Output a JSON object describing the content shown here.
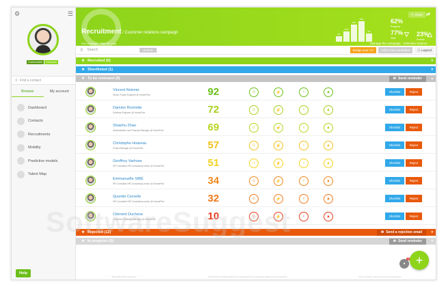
{
  "sidebar": {
    "role_tags": [
      "Customizable",
      "Enterprise"
    ],
    "search_placeholder": "Find a contact",
    "tabs": [
      "Browse",
      "My account"
    ],
    "items": [
      "Dashboard",
      "Contacts",
      "Recruitments",
      "Mobility",
      "Predictive models",
      "Talent Map"
    ],
    "help": "Help"
  },
  "header": {
    "title": "Recruitment",
    "subtitle": " / Customer relations campaign",
    "links": [
      "See rankings",
      "See the map"
    ],
    "share": "Share",
    "stat_progress": "62%",
    "stat_progress_label": "Progress",
    "stat_male": "77%",
    "stat_male_label": "Male",
    "stat_female": "23%",
    "stat_female_label": "Female",
    "bar_labels": [
      "9%",
      "18%",
      "30%",
      "33%",
      "9%"
    ],
    "bar_values": [
      0.27,
      0.5,
      0.82,
      1.0,
      0.4
    ],
    "manage": "Manage the campaign - Velentine Salmon"
  },
  "toolbar": {
    "search_placeholder": "Search",
    "search_button": "Search",
    "btn_import": "Bridge your CV",
    "btn_add": "Add a new candidate",
    "btn_legend": "Legend"
  },
  "sections": {
    "recruited": "Recruited (0)",
    "shortlisted": "Shortlisted (1)",
    "to_review": "To be reviewed (8)",
    "send_reminder": "Send reminder",
    "rejected": "Rejected (12)",
    "send_rejection": "Send a rejection email",
    "in_progress": "In progress (0)",
    "send_reminder2": "Send reminder"
  },
  "candidates": [
    {
      "name": "Vincent Noisner",
      "role": "Senior Project Engineer @ HoosePrint",
      "score": "92",
      "color": "#6cbf1a"
    },
    {
      "name": "Damien Rochette",
      "role": "Software Engineer @ HoosePrint",
      "score": "72",
      "color": "#a8cf1e"
    },
    {
      "name": "Shaizhu Zhao",
      "role": "Administrative and Financial Manager @ HoosePrint",
      "score": "69",
      "color": "#b8d420"
    },
    {
      "name": "Christophe Hoareau",
      "role": "Project Manager @ HoosePrint",
      "score": "57",
      "color": "#f1c21e"
    },
    {
      "name": "Geoffroy Varhose",
      "role": "HR Consultant HR Consultancy sector @ HoosePrint",
      "score": "51",
      "color": "#f4d21e"
    },
    {
      "name": "Emmanuelle SIBÉ",
      "role": "HR Consultant HR Consultancy sector @ HoosePrint",
      "score": "34",
      "color": "#f08a1e"
    },
    {
      "name": "Quentin Cervelle",
      "role": "HR Consultant HR Consultancy sector @ HoosePrint",
      "score": "32",
      "color": "#f07a1e"
    },
    {
      "name": "Clément Duchene",
      "role": "Customer Relations Manager @ HoosePrint",
      "score": "10",
      "color": "#e53e1e"
    }
  ],
  "row_buttons": {
    "shortlist": "Shortlist",
    "reject": "Reject"
  },
  "footer": [
    "Web 2012-2017 Clustore #",
    "©2013-2017 All Rights Reserved. HoosePrint® is a registered trademark of HoosePrint",
    "CGU | Contact | General Terms and Conditions"
  ],
  "notifications": "15",
  "watermark": "SoftwareSuggest"
}
